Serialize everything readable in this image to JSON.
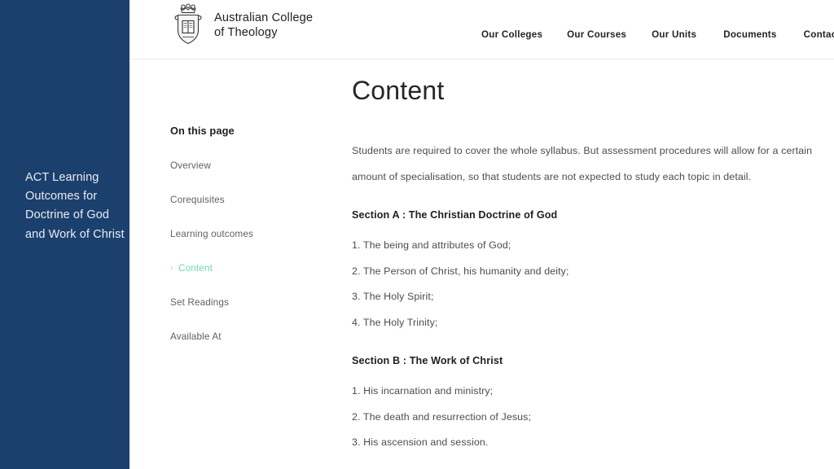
{
  "rail": {
    "title": "ACT Learning Outcomes for Doctrine of God and Work of Christ",
    "background_color": "#1c406e",
    "text_color": "#e9ecef"
  },
  "header": {
    "logo_icon": "college-crest-icon",
    "brand_line1": "Australian College",
    "brand_line2": "of Theology",
    "brand_name": "Australian College\nof Theology",
    "nav": [
      {
        "label": "Our Colleges"
      },
      {
        "label": "Our Courses"
      },
      {
        "label": "Our Units"
      },
      {
        "label": "Documents"
      },
      {
        "label": "Contact"
      }
    ]
  },
  "toc": {
    "heading": "On this page",
    "chevron": "›",
    "active_color": "#72d6b5",
    "items": [
      {
        "label": "Overview",
        "active": false
      },
      {
        "label": "Corequisites",
        "active": false
      },
      {
        "label": "Learning outcomes",
        "active": false
      },
      {
        "label": "Content",
        "active": true
      },
      {
        "label": "Set Readings",
        "active": false
      },
      {
        "label": "Available At",
        "active": false
      }
    ]
  },
  "article": {
    "title": "Content",
    "intro": "Students are required to cover the whole syllabus. But assessment procedures will allow for a certain amount of specialisation, so that students are not expected to study each topic in detail.",
    "sections": [
      {
        "heading": "Section A : The Christian Doctrine of God",
        "items": [
          "1. The being and attributes of God;",
          "2. The Person of Christ, his humanity and deity;",
          "3. The Holy Spirit;",
          "4. The Holy Trinity;"
        ]
      },
      {
        "heading": "Section B : The Work of Christ",
        "items": [
          "1. His incarnation and ministry;",
          "2. The death and resurrection of Jesus;",
          "3. His ascension and session."
        ]
      }
    ]
  }
}
